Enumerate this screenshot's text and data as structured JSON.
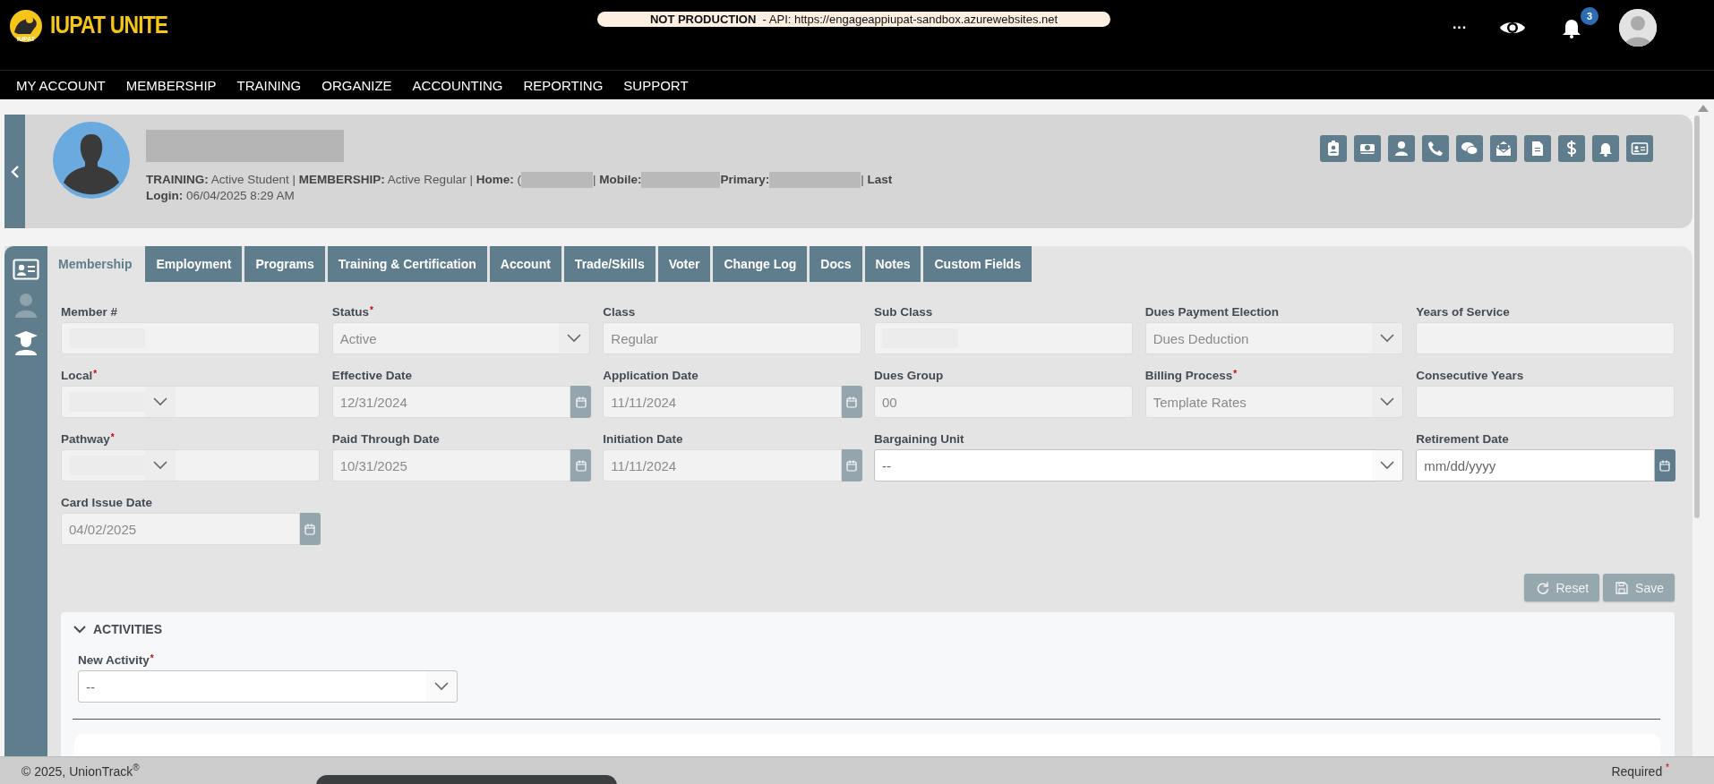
{
  "logo": {
    "text": "IUPAT UNITE",
    "subtext": "IUPAT"
  },
  "environment": {
    "label": "NOT PRODUCTION",
    "text": " - API: https://engageappiupat-sandbox.azurewebsites.net"
  },
  "header_actions": {
    "more": "···",
    "notifications": "3"
  },
  "nav": [
    "MY ACCOUNT",
    "MEMBERSHIP",
    "TRAINING",
    "ORGANIZE",
    "ACCOUNTING",
    "REPORTING",
    "SUPPORT"
  ],
  "profile": {
    "name_redacted": true,
    "info": [
      {
        "text": "**TRAINING:** Active Student | **MEMBERSHIP:** Active Regular | **Home:** ("
      },
      {
        "redacted": true
      },
      {
        "text": "| **Mobile:**"
      },
      {
        "redacted": true
      },
      {
        "text": "**Primary:**"
      },
      {
        "redacted": true
      },
      {
        "text": "| **Last**"
      }
    ],
    "login": "**Login:** 06/04/2025 8:29 AM"
  },
  "tabs": [
    {
      "label": "Membership",
      "selected": true
    },
    {
      "label": "Employment",
      "selected": false
    },
    {
      "label": "Programs",
      "selected": false
    },
    {
      "label": "Training & Certification",
      "selected": false
    },
    {
      "label": "Account",
      "selected": false
    },
    {
      "label": "Trade/Skills",
      "selected": false
    },
    {
      "label": "Voter",
      "selected": false
    },
    {
      "label": "Change Log",
      "selected": false
    },
    {
      "label": "Docs",
      "selected": false
    },
    {
      "label": "Notes",
      "selected": false
    },
    {
      "label": "Custom Fields",
      "selected": false
    }
  ],
  "fields": [
    {
      "label": "Member #",
      "kind": "text",
      "required": false,
      "disabled": true,
      "redacted": true
    },
    {
      "label": "Status",
      "kind": "select",
      "required": true,
      "disabled": true,
      "value": "Active"
    },
    {
      "label": "Class",
      "kind": "text",
      "required": false,
      "disabled": true,
      "value": "Regular"
    },
    {
      "label": "Sub Class",
      "kind": "text",
      "required": false,
      "disabled": true,
      "redacted": true
    },
    {
      "label": "Dues Payment Election",
      "kind": "select",
      "required": false,
      "disabled": true,
      "value": "Dues Deduction"
    },
    {
      "label": "Years of Service",
      "kind": "text",
      "required": false,
      "disabled": true
    },
    {
      "label": "Local",
      "kind": "select",
      "required": true,
      "disabled": true,
      "redacted": true
    },
    {
      "label": "Effective Date",
      "kind": "date",
      "required": false,
      "disabled": true,
      "value": "12/31/2024"
    },
    {
      "label": "Application Date",
      "kind": "date",
      "required": false,
      "disabled": true,
      "value": "11/11/2024"
    },
    {
      "label": "Dues Group",
      "kind": "text",
      "required": false,
      "disabled": true,
      "value": "00"
    },
    {
      "label": "Billing Process",
      "kind": "select",
      "required": true,
      "disabled": true,
      "value": "Template Rates"
    },
    {
      "label": "Consecutive Years",
      "kind": "text",
      "required": false,
      "disabled": true
    },
    {
      "label": "Pathway",
      "kind": "select",
      "required": true,
      "disabled": true,
      "redacted": true
    },
    {
      "label": "Paid Through Date",
      "kind": "date",
      "required": false,
      "disabled": true,
      "value": "10/31/2025"
    },
    {
      "label": "Initiation Date",
      "kind": "date",
      "required": false,
      "disabled": true,
      "value": "11/11/2024"
    },
    {
      "label": "Bargaining Unit",
      "kind": "select",
      "required": false,
      "disabled": false,
      "wide": true,
      "value": "--"
    },
    {
      "label": "Retirement Date",
      "kind": "date",
      "required": false,
      "disabled": false,
      "placeholder": "mm/dd/yyyy"
    },
    {
      "label": "Card Issue Date",
      "kind": "date",
      "required": false,
      "disabled": true,
      "value": "04/02/2025"
    }
  ],
  "buttons": [
    {
      "label": "Reset",
      "kind": "reset",
      "disabled": true
    },
    {
      "label": "Save",
      "kind": "save",
      "disabled": true
    }
  ],
  "activities": {
    "title": "ACTIVITIES",
    "expanded": true,
    "field": {
      "label": "New Activity",
      "required": true,
      "value": "--"
    }
  },
  "footer": {
    "copyright": "© 2025, UnionTrack$^{®}$",
    "required_label": "Required",
    "required_mark": "*"
  }
}
